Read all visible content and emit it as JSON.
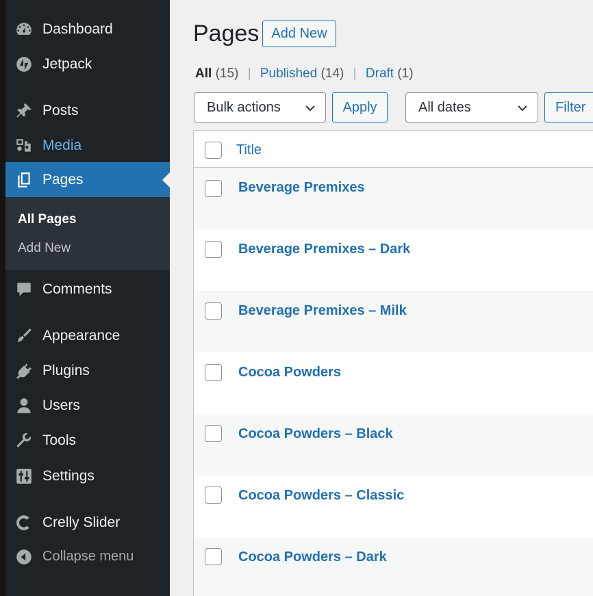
{
  "sidebar": {
    "items": [
      {
        "label": "Dashboard",
        "icon": "dashboard-icon"
      },
      {
        "label": "Jetpack",
        "icon": "jetpack-icon"
      },
      {
        "label": "Posts",
        "icon": "pushpin-icon"
      },
      {
        "label": "Media",
        "icon": "media-icon"
      },
      {
        "label": "Pages",
        "icon": "pages-icon"
      },
      {
        "label": "Comments",
        "icon": "comment-icon"
      },
      {
        "label": "Appearance",
        "icon": "paintbrush-icon"
      },
      {
        "label": "Plugins",
        "icon": "plug-icon"
      },
      {
        "label": "Users",
        "icon": "user-icon"
      },
      {
        "label": "Tools",
        "icon": "wrench-icon"
      },
      {
        "label": "Settings",
        "icon": "settings-sliders-icon"
      },
      {
        "label": "Crelly Slider",
        "icon": "crelly-c-icon"
      },
      {
        "label": "Collapse menu",
        "icon": "collapse-arrow-icon"
      }
    ],
    "submenu": [
      {
        "label": "All Pages"
      },
      {
        "label": "Add New"
      }
    ]
  },
  "header": {
    "title": "Pages",
    "add_new": "Add New"
  },
  "filters": {
    "all_label": "All",
    "all_count": "(15)",
    "published_label": "Published",
    "published_count": "(14)",
    "draft_label": "Draft",
    "draft_count": "(1)",
    "separator": "|"
  },
  "toolbar": {
    "bulk_actions": "Bulk actions",
    "apply": "Apply",
    "all_dates": "All dates",
    "filter": "Filter"
  },
  "table": {
    "column_title": "Title",
    "rows": [
      {
        "title": "Beverage Premixes"
      },
      {
        "title": "Beverage Premixes – Dark"
      },
      {
        "title": "Beverage Premixes – Milk"
      },
      {
        "title": "Cocoa Powders"
      },
      {
        "title": "Cocoa Powders – Black"
      },
      {
        "title": "Cocoa Powders – Classic"
      },
      {
        "title": "Cocoa Powders – Dark"
      }
    ]
  },
  "colors": {
    "sidebar_bg": "#1d2327",
    "active_bg": "#2271b1",
    "link": "#2271b1",
    "media_highlight": "#72aee6"
  }
}
